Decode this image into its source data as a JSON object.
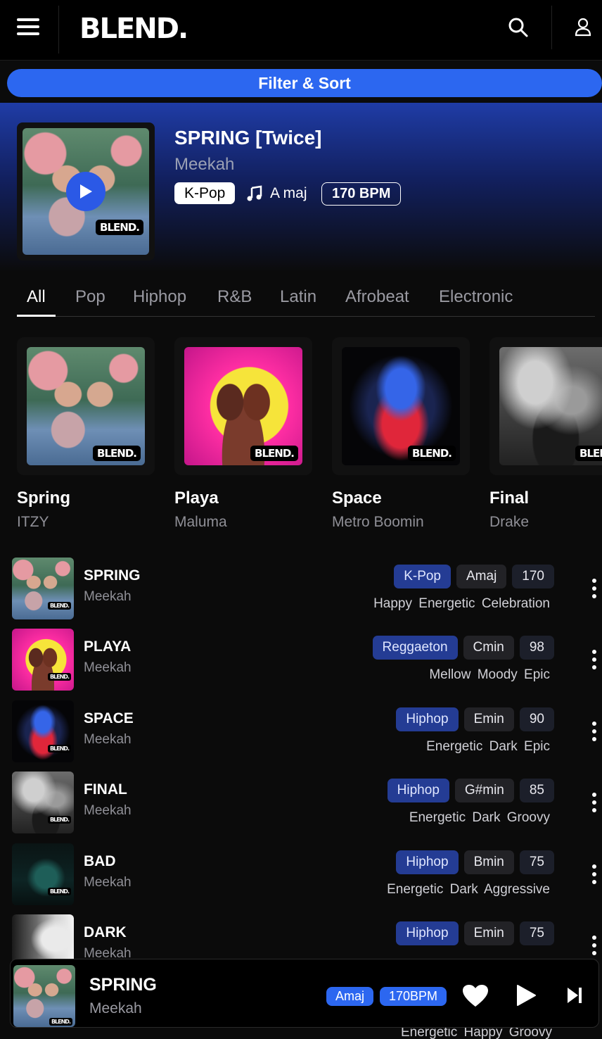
{
  "header": {
    "logo": "BLEND."
  },
  "filter": {
    "label": "Filter & Sort"
  },
  "hero": {
    "title": "SPRING [Twice]",
    "artist": "Meekah",
    "genre": "K-Pop",
    "key": "A maj",
    "bpm": "170 BPM",
    "badge": "BLEND."
  },
  "tabs": [
    "All",
    "Pop",
    "Hiphop",
    "R&B",
    "Latin",
    "Afrobeat",
    "Electronic"
  ],
  "cards": [
    {
      "title": "Spring",
      "artist": "ITZY",
      "badge": "BLEND."
    },
    {
      "title": "Playa",
      "artist": "Maluma",
      "badge": "BLEND."
    },
    {
      "title": "Space",
      "artist": "Metro Boomin",
      "badge": "BLEND."
    },
    {
      "title": "Final",
      "artist": "Drake",
      "badge": "BLEND."
    }
  ],
  "tracks": [
    {
      "title": "SPRING",
      "artist": "Meekah",
      "genre": "K-Pop",
      "key": "Amaj",
      "bpm": "170",
      "moods": "Happy Energetic Celebration",
      "badge": "BLEND."
    },
    {
      "title": "PLAYA",
      "artist": "Meekah",
      "genre": "Reggaeton",
      "key": "Cmin",
      "bpm": "98",
      "moods": "Mellow Moody Epic",
      "badge": "BLEND."
    },
    {
      "title": "SPACE",
      "artist": "Meekah",
      "genre": "Hiphop",
      "key": "Emin",
      "bpm": "90",
      "moods": "Energetic Dark Epic",
      "badge": "BLEND."
    },
    {
      "title": "FINAL",
      "artist": "Meekah",
      "genre": "Hiphop",
      "key": "G#min",
      "bpm": "85",
      "moods": "Energetic Dark Groovy",
      "badge": "BLEND."
    },
    {
      "title": "BAD",
      "artist": "Meekah",
      "genre": "Hiphop",
      "key": "Bmin",
      "bpm": "75",
      "moods": "Energetic Dark Aggressive",
      "badge": "BLEND."
    },
    {
      "title": "DARK",
      "artist": "Meekah",
      "genre": "Hiphop",
      "key": "Emin",
      "bpm": "75",
      "moods": "",
      "badge": ""
    }
  ],
  "player": {
    "title": "SPRING",
    "artist": "Meekah",
    "key": "Amaj",
    "bpm": "170BPM",
    "badge": "BLEND."
  },
  "peek_moods": "Energetic Happy Groovy"
}
